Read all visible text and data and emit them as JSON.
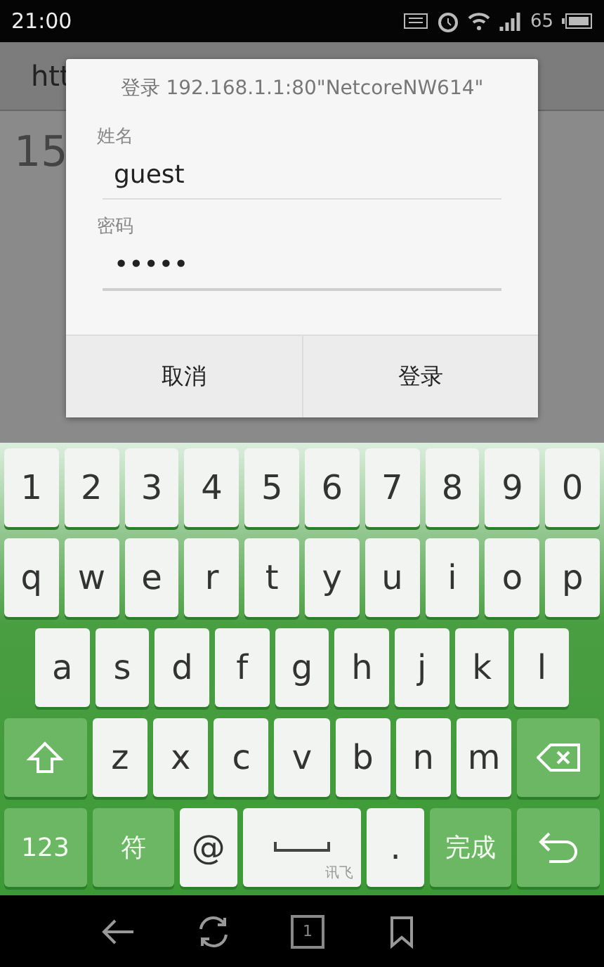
{
  "status_bar": {
    "time": "21:00",
    "battery": "65"
  },
  "browser": {
    "url": "htt",
    "page_text": "15"
  },
  "dialog": {
    "title": "登录 192.168.1.1:80\"NetcoreNW614\"",
    "fields": [
      {
        "label": "姓名",
        "value": "guest",
        "focused": false
      },
      {
        "label": "密码",
        "value": "•••••",
        "focused": true
      }
    ],
    "buttons": [
      "取消",
      "登录"
    ]
  },
  "keyboard": {
    "number_keys": [
      {
        "kind": "letter",
        "label": "1"
      },
      {
        "kind": "letter",
        "label": "2"
      },
      {
        "kind": "letter",
        "label": "3"
      },
      {
        "kind": "letter",
        "label": "4"
      },
      {
        "kind": "letter",
        "label": "5"
      },
      {
        "kind": "letter",
        "label": "6"
      },
      {
        "kind": "letter",
        "label": "7"
      },
      {
        "kind": "letter",
        "label": "8"
      },
      {
        "kind": "letter",
        "label": "9"
      },
      {
        "kind": "letter",
        "label": "0"
      }
    ],
    "top_letter_keys": [
      {
        "kind": "letter",
        "label": "q"
      },
      {
        "kind": "letter",
        "label": "w"
      },
      {
        "kind": "letter",
        "label": "e"
      },
      {
        "kind": "letter",
        "label": "r"
      },
      {
        "kind": "letter",
        "label": "t"
      },
      {
        "kind": "letter",
        "label": "y"
      },
      {
        "kind": "letter",
        "label": "u"
      },
      {
        "kind": "letter",
        "label": "i"
      },
      {
        "kind": "letter",
        "label": "o"
      },
      {
        "kind": "letter",
        "label": "p"
      }
    ],
    "middle_letter_keys": [
      {
        "kind": "letter",
        "label": "a"
      },
      {
        "kind": "letter",
        "label": "s"
      },
      {
        "kind": "letter",
        "label": "d"
      },
      {
        "kind": "letter",
        "label": "f"
      },
      {
        "kind": "letter",
        "label": "g"
      },
      {
        "kind": "letter",
        "label": "h"
      },
      {
        "kind": "letter",
        "label": "j"
      },
      {
        "kind": "letter",
        "label": "k"
      },
      {
        "kind": "letter",
        "label": "l"
      }
    ],
    "bottom_letter_keys": [
      {
        "kind": "shift"
      },
      {
        "kind": "letter",
        "label": "z"
      },
      {
        "kind": "letter",
        "label": "x"
      },
      {
        "kind": "letter",
        "label": "c"
      },
      {
        "kind": "letter",
        "label": "v"
      },
      {
        "kind": "letter",
        "label": "b"
      },
      {
        "kind": "letter",
        "label": "n"
      },
      {
        "kind": "letter",
        "label": "m"
      },
      {
        "kind": "backspace"
      }
    ],
    "action_keys": [
      {
        "kind": "function",
        "label": "123"
      },
      {
        "kind": "function",
        "label": "符"
      },
      {
        "kind": "letter",
        "label": "@"
      },
      {
        "kind": "space",
        "label": "讯飞"
      },
      {
        "kind": "letter",
        "label": "."
      },
      {
        "kind": "function",
        "label": "完成"
      },
      {
        "kind": "return"
      }
    ]
  },
  "nav_bar": {
    "tab_count": "1"
  }
}
